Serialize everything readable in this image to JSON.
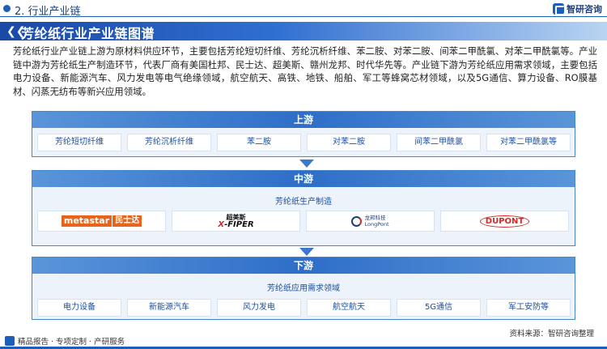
{
  "header": {
    "section": "2. 行业产业链",
    "brand": "智研咨询"
  },
  "banner": {
    "title": "芳纶纸行业产业链图谱"
  },
  "intro": "芳纶纸行业产业链上游为原材料供应环节，主要包括芳纶短切纤维、芳纶沉析纤维、苯二胺、对苯二胺、间苯二甲酰氯、对苯二甲酰氯等。产业链中游为芳纶纸生产制造环节，代表厂商有美国杜邦、民士达、超美斯、赣州龙邦、时代华先等。产业链下游为芳纶纸应用需求领域，主要包括电力设备、新能源汽车、风力发电等电气绝缘领域，航空航天、高铁、地铁、船舶、军工等蜂窝芯材领域，以及5G通信、算力设备、RO膜基材、闪蒸无纺布等新兴应用领域。",
  "upstream": {
    "title": "上游",
    "items": [
      "芳纶短切纤维",
      "芳纶沉析纤维",
      "苯二胺",
      "对苯二胺",
      "间苯二甲酰氯",
      "对苯二甲酰氯等"
    ]
  },
  "midstream": {
    "title": "中游",
    "subtitle": "芳纶纸生产制造",
    "logos": {
      "metastar_en": "metastar",
      "metastar_cn": "民士达",
      "xfiper_cn": "超美斯",
      "xfiper_en_x": "X",
      "xfiper_en_rest": "-FIPER",
      "longpont_cn": "龙邦科技",
      "longpont_en": "LongPont",
      "dupont": "DUPONT"
    }
  },
  "downstream": {
    "title": "下游",
    "subtitle": "芳纶纸应用需求领域",
    "items": [
      "电力设备",
      "新能源汽车",
      "风力发电",
      "航空航天",
      "5G通信",
      "军工安防等"
    ]
  },
  "footer": {
    "left": "精品报告 · 专项定制 · 产研服务",
    "source": "资料来源：智研咨询整理"
  },
  "colors": {
    "primary": "#1c5fb8",
    "stage_border": "#4a86cf",
    "stage_bg": "#edf3fb"
  }
}
